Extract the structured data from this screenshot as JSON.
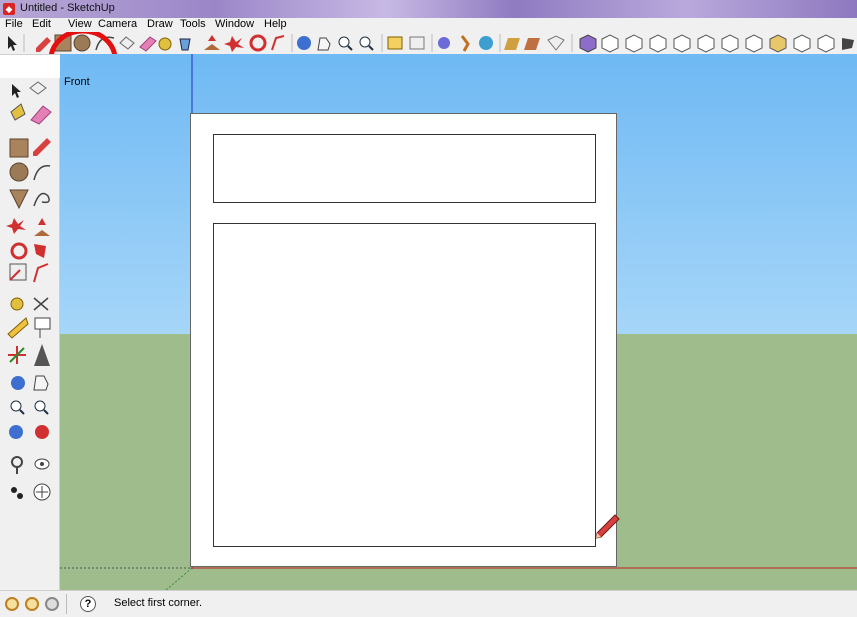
{
  "window": {
    "title": "Untitled - SketchUp",
    "app_icon": "sketchup-logo-icon"
  },
  "menu": [
    "File",
    "Edit",
    "View",
    "Camera",
    "Draw",
    "Tools",
    "Window",
    "Help"
  ],
  "toolbar": {
    "highlight_color": "#e41010",
    "icons": [
      "select-arrow-icon",
      "line-pencil-icon",
      "rectangle-icon",
      "circle-icon",
      "arc-icon",
      "make-component-icon",
      "eraser-icon",
      "tape-measure-icon",
      "paint-bucket-icon",
      "push-pull-icon",
      "move-icon",
      "rotate-icon",
      "follow-me-icon",
      "orbit-icon",
      "pan-icon",
      "zoom-icon",
      "zoom-extents-icon",
      "previous-view-icon",
      "next-view-icon",
      "position-camera-icon",
      "walk-icon",
      "look-around-icon",
      "section-plane-icon",
      "iso-view-icon",
      "top-view-icon",
      "front-view-icon",
      "right-view-icon",
      "back-view-icon"
    ]
  },
  "scene": {
    "view_label": "Front",
    "sky_color": "#7fc3f6",
    "ground_color": "#9fbc8c"
  },
  "left_toolbar": {
    "icons": [
      "select-arrow-icon",
      "make-component-icon",
      "paint-bucket-icon",
      "eraser-icon",
      "rectangle-icon",
      "line-pencil-icon",
      "circle-icon",
      "arc-icon",
      "polygon-icon",
      "freehand-icon",
      "move-icon",
      "push-pull-icon",
      "rotate-icon",
      "follow-me-icon",
      "scale-icon",
      "offset-icon",
      "tape-measure-icon",
      "dimension-icon",
      "protractor-icon",
      "text-icon",
      "axes-icon",
      "3d-text-icon",
      "orbit-icon",
      "pan-icon",
      "zoom-icon",
      "zoom-window-icon",
      "zoom-extents-icon",
      "previous-icon",
      "position-camera-icon",
      "look-around-icon",
      "walk-icon",
      "section-plane-icon"
    ]
  },
  "status": {
    "text": "Select first corner.",
    "help_glyph": "?"
  }
}
